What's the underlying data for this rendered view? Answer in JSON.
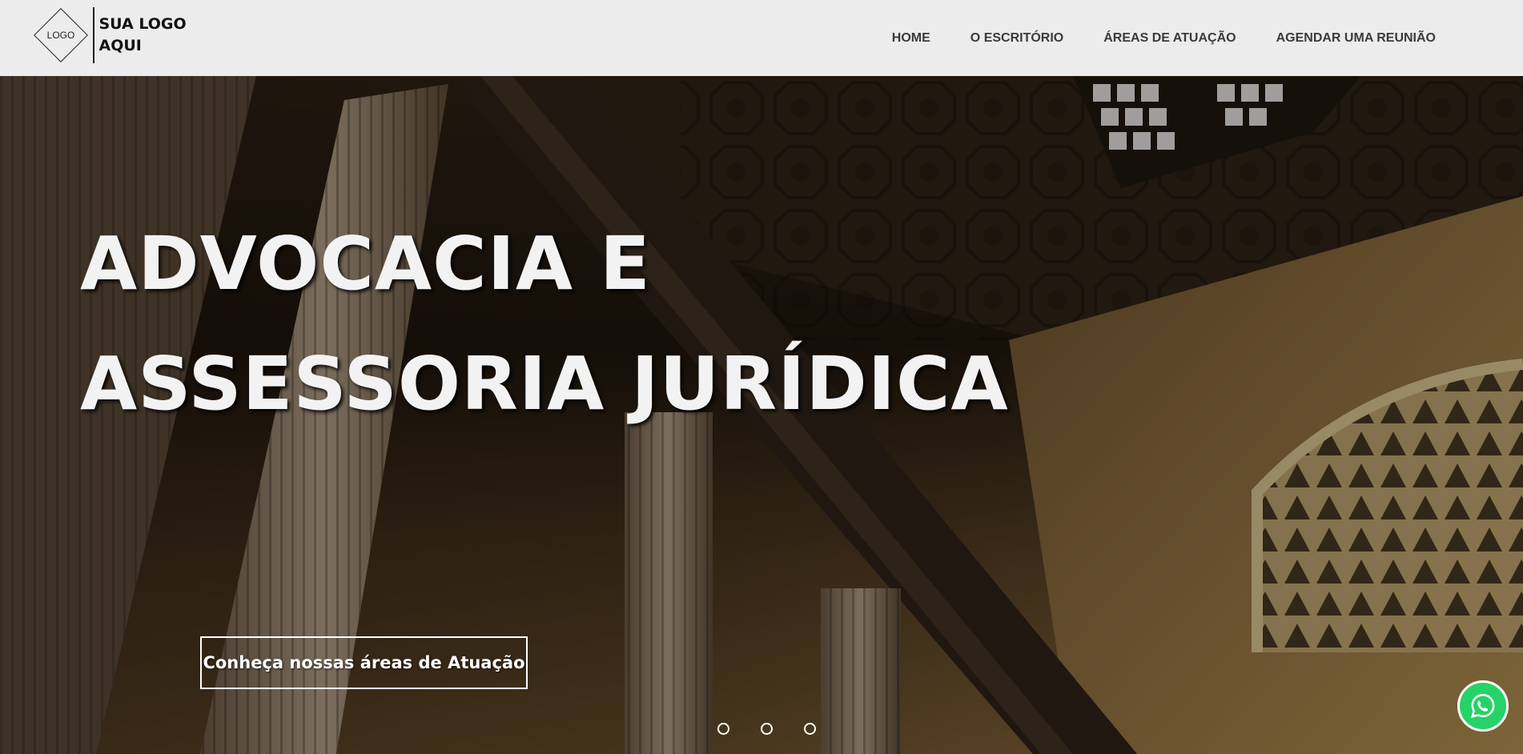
{
  "header": {
    "logo_mark_text": "LOGO",
    "logo_text_line1": "SUA LOGO",
    "logo_text_line2": "AQUI",
    "nav": [
      {
        "label": "HOME"
      },
      {
        "label": "O ESCRITÓRIO"
      },
      {
        "label": "ÁREAS DE ATUAÇÃO"
      },
      {
        "label": "AGENDAR UMA REUNIÃO"
      }
    ]
  },
  "hero": {
    "title_line1": "ADVOCACIA E",
    "title_line2": "ASSESSORIA JURÍDICA",
    "cta_label": "Conheça nossas áreas de Atuação",
    "slides_count": 3
  },
  "floating": {
    "whatsapp_icon": "whatsapp-icon"
  },
  "colors": {
    "header_bg": "#ececec",
    "nav_text": "#3a3a3a",
    "hero_text": "#f2f2f2",
    "whatsapp_green": "#25d366"
  }
}
